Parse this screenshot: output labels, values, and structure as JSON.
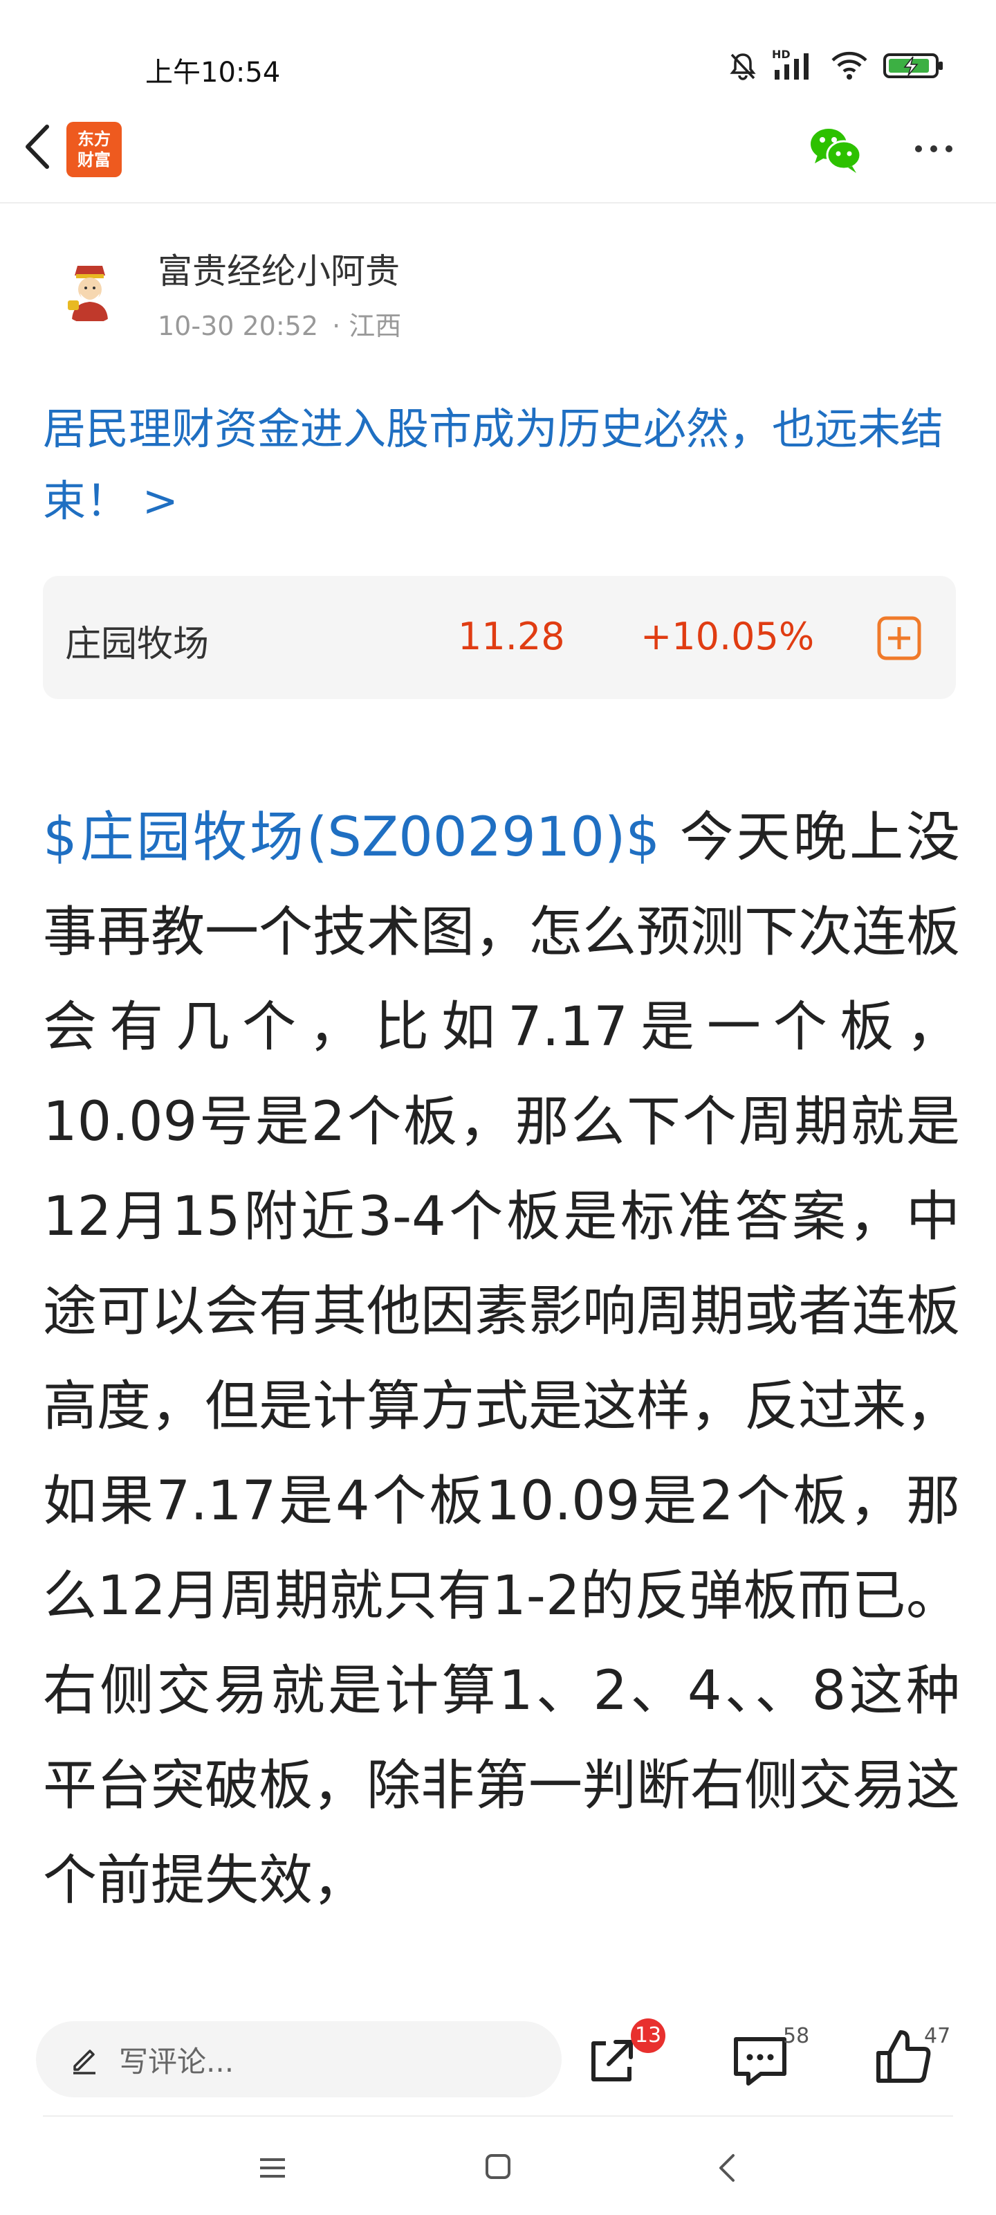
{
  "status_bar": {
    "time": "上午10:54",
    "signal_label": "HD"
  },
  "app": {
    "logo_line1": "东方",
    "logo_line2": "财富"
  },
  "author": {
    "name": "富贵经纶小阿贵",
    "datetime": "10-30 20:52",
    "location": "· 江西"
  },
  "post": {
    "title": "居民理财资金进入股市成为历史必然，也远未结束！ >",
    "stock_link": "$庄园牧场(SZ002910)$",
    "body": " 今天晚上没事再教一个技术图，怎么预测下次连板会有几个，比如7.17是一个板，10.09号是2个板，那么下个周期就是12月15附近3-4个板是标准答案，中途可以会有其他因素影响周期或者连板高度，但是计算方式是这样，反过来，如果7.17是4个板10.09是2个板，那么12月周期就只有1-2的反弹板而已。右侧交易就是计算1、2、4、、8这种平台突破板，除非第一判断右侧交易这个前提失效，"
  },
  "stock_card": {
    "name": "庄园牧场",
    "price": "11.28",
    "change": "+10.05%"
  },
  "bottom_bar": {
    "comment_placeholder": "写评论...",
    "share_count": "13",
    "comment_count": "58",
    "like_count": "47"
  },
  "colors": {
    "link_blue": "#1f6fc2",
    "up_red": "#e03c12",
    "brand_orange": "#ee5a1f",
    "wechat_green": "#2dc100"
  }
}
